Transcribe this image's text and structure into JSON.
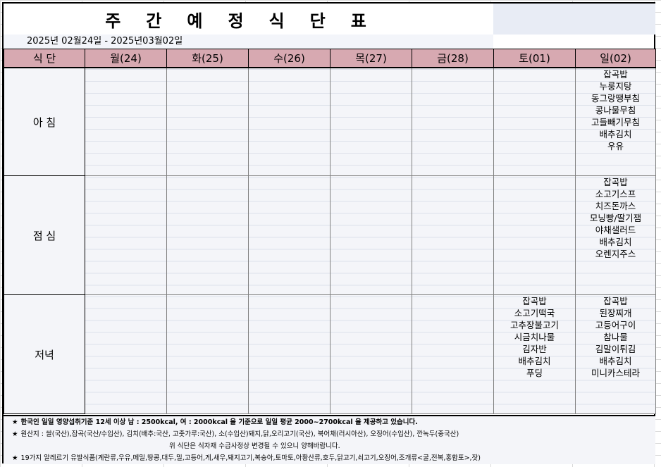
{
  "title": "주간예정식단표",
  "date_range": "2025년  02월24일  -  2025년03월02일",
  "header": {
    "meal_col": "식 단",
    "days": [
      "월(24)",
      "화(25)",
      "수(26)",
      "목(27)",
      "금(28)",
      "토(01)",
      "일(02)"
    ]
  },
  "meals": [
    {
      "label": "아 침",
      "cells": [
        [],
        [],
        [],
        [],
        [],
        [],
        [
          "잡곡밥",
          "누룽지탕",
          "동그랑땡부침",
          "콩나물무침",
          "고들빼기무침",
          "배추김치",
          "우유"
        ]
      ]
    },
    {
      "label": "점 심",
      "cells": [
        [],
        [],
        [],
        [],
        [],
        [],
        [
          "잡곡밥",
          "소고기스프",
          "치즈돈까스",
          "모닝빵/딸기잼",
          "야채샐러드",
          "배추김치",
          "오렌지주스"
        ]
      ]
    },
    {
      "label": "저녁",
      "cells": [
        [],
        [],
        [],
        [],
        [],
        [
          "잡곡밥",
          "소고기떡국",
          "고추장불고기",
          "시금치나물",
          "김자반",
          "배추김치",
          "푸딩"
        ],
        [
          "잡곡밥",
          "된장찌개",
          "고등어구이",
          "참나물",
          "김말이튀김",
          "배추김치",
          "미니카스테라"
        ]
      ]
    }
  ],
  "notes": {
    "line1": "한국인 일일 영양섭취기준 12세 이상 남 : 2500kcal, 여 : 2000kcal 을 기준으로 일일 평균 2000~2700kcal 을 제공하고 있습니다.",
    "line2": "원산지 : 쌀(국산),잡곡(국산/수입산), 김치(배추:국산, 고춧가루:국산), 소(수입산)돼지,닭,오리고기(국산), 북어채(러시아산), 오징어(수입산), 깐녹두(중국산)",
    "line3": "위 식단은 식자재 수급사정상 변경될 수 있으니 양해바랍니다.",
    "line4": "19가지 알레르기 유발식품(계란류,우유,메밀,땅콩,대두,밀,고등어,게,새우,돼지고기,복숭아,토마토,아황산류,호두,닭고기,쇠고기,오징어,조개류<굴,전복,홍합포>,잣)",
    "star": "★"
  }
}
